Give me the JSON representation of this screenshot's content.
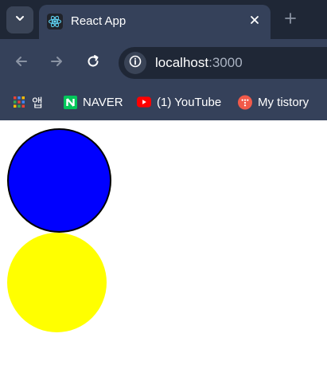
{
  "browser": {
    "tab": {
      "title": "React App"
    },
    "address_bar": {
      "host": "localhost",
      "port": ":3000"
    },
    "bookmarks": [
      {
        "label": "앱",
        "icon": "apps-grid-icon"
      },
      {
        "label": "NAVER",
        "icon": "naver-icon"
      },
      {
        "label": "(1) YouTube",
        "icon": "youtube-icon"
      },
      {
        "label": "My tistory",
        "icon": "tistory-icon"
      }
    ]
  },
  "page": {
    "circles": [
      {
        "name": "blue-circle",
        "color": "#0000ff",
        "border": "#000000"
      },
      {
        "name": "yellow-circle",
        "color": "#ffff00"
      }
    ]
  },
  "colors": {
    "tabstrip": "#1f2736",
    "toolbar": "#35415a",
    "naver_green": "#03c75a",
    "youtube_red": "#ff0000",
    "tistory_orange": "#f15a4a"
  }
}
